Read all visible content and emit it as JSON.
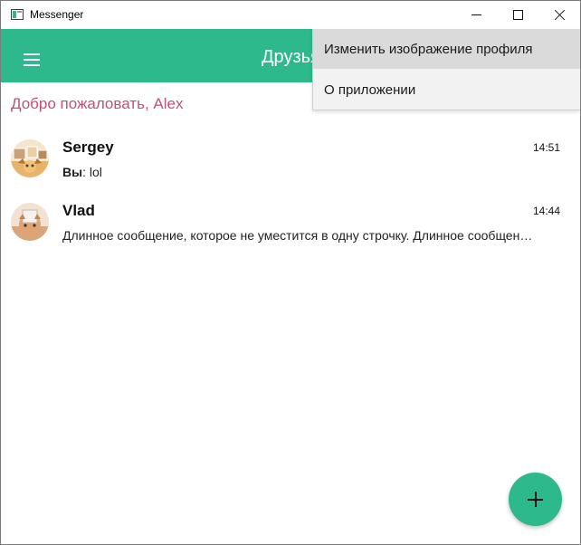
{
  "window": {
    "title": "Messenger",
    "icon": "app-window-icon",
    "controls": [
      "minimize-icon",
      "maximize-icon",
      "close-icon"
    ]
  },
  "appbar": {
    "menu_icon": "hamburger-icon",
    "title": "Друзья",
    "accent_color": "#2db98c"
  },
  "menu": {
    "items": [
      {
        "label": "Изменить изображение профиля",
        "highlighted": true
      },
      {
        "label": "О приложении",
        "highlighted": false
      }
    ]
  },
  "welcome": {
    "text": "Добро пожаловать, Alex",
    "color": "#c0507a"
  },
  "chats": [
    {
      "name": "Sergey",
      "time": "14:51",
      "prefix": "Вы",
      "message": "lol",
      "avatar": "cat-photo-avatar"
    },
    {
      "name": "Vlad",
      "time": "14:44",
      "prefix": "",
      "message": "Длинное сообщение, которое не уместится в одну строчку. Длинное сообщение, которое не уместится в одну строчку.",
      "avatar": "cat-photo-avatar"
    }
  ],
  "fab": {
    "icon": "plus-icon"
  }
}
